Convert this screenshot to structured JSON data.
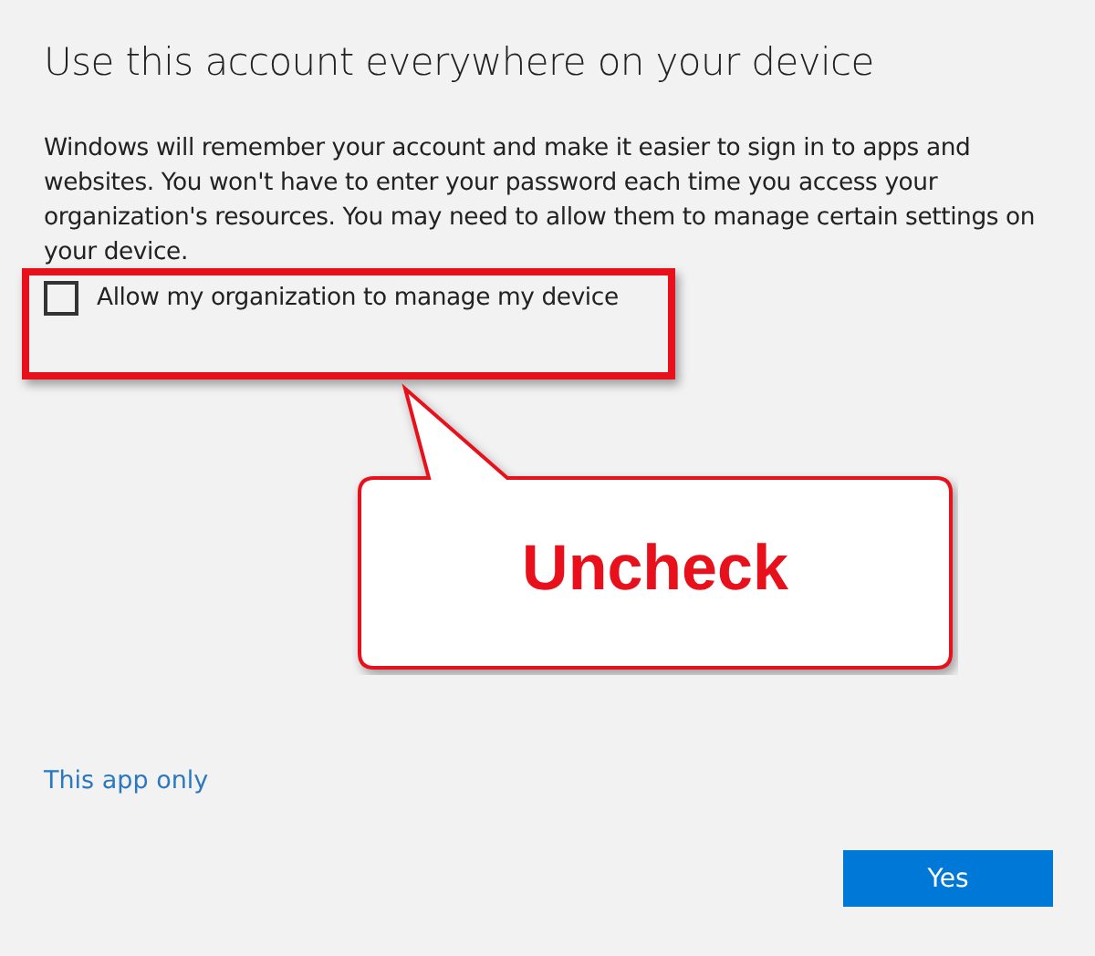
{
  "dialog": {
    "title": "Use this account everywhere on your device",
    "body": "Windows will remember your account and make it easier to sign in to apps and websites. You won't have to enter your password each time you access your organization's resources. You may need to allow them to manage certain settings on your device.",
    "checkbox": {
      "label": "Allow my organization to manage my device",
      "checked": false
    },
    "link": "This app only",
    "button": "Yes"
  },
  "annotation": {
    "callout": "Uncheck"
  }
}
